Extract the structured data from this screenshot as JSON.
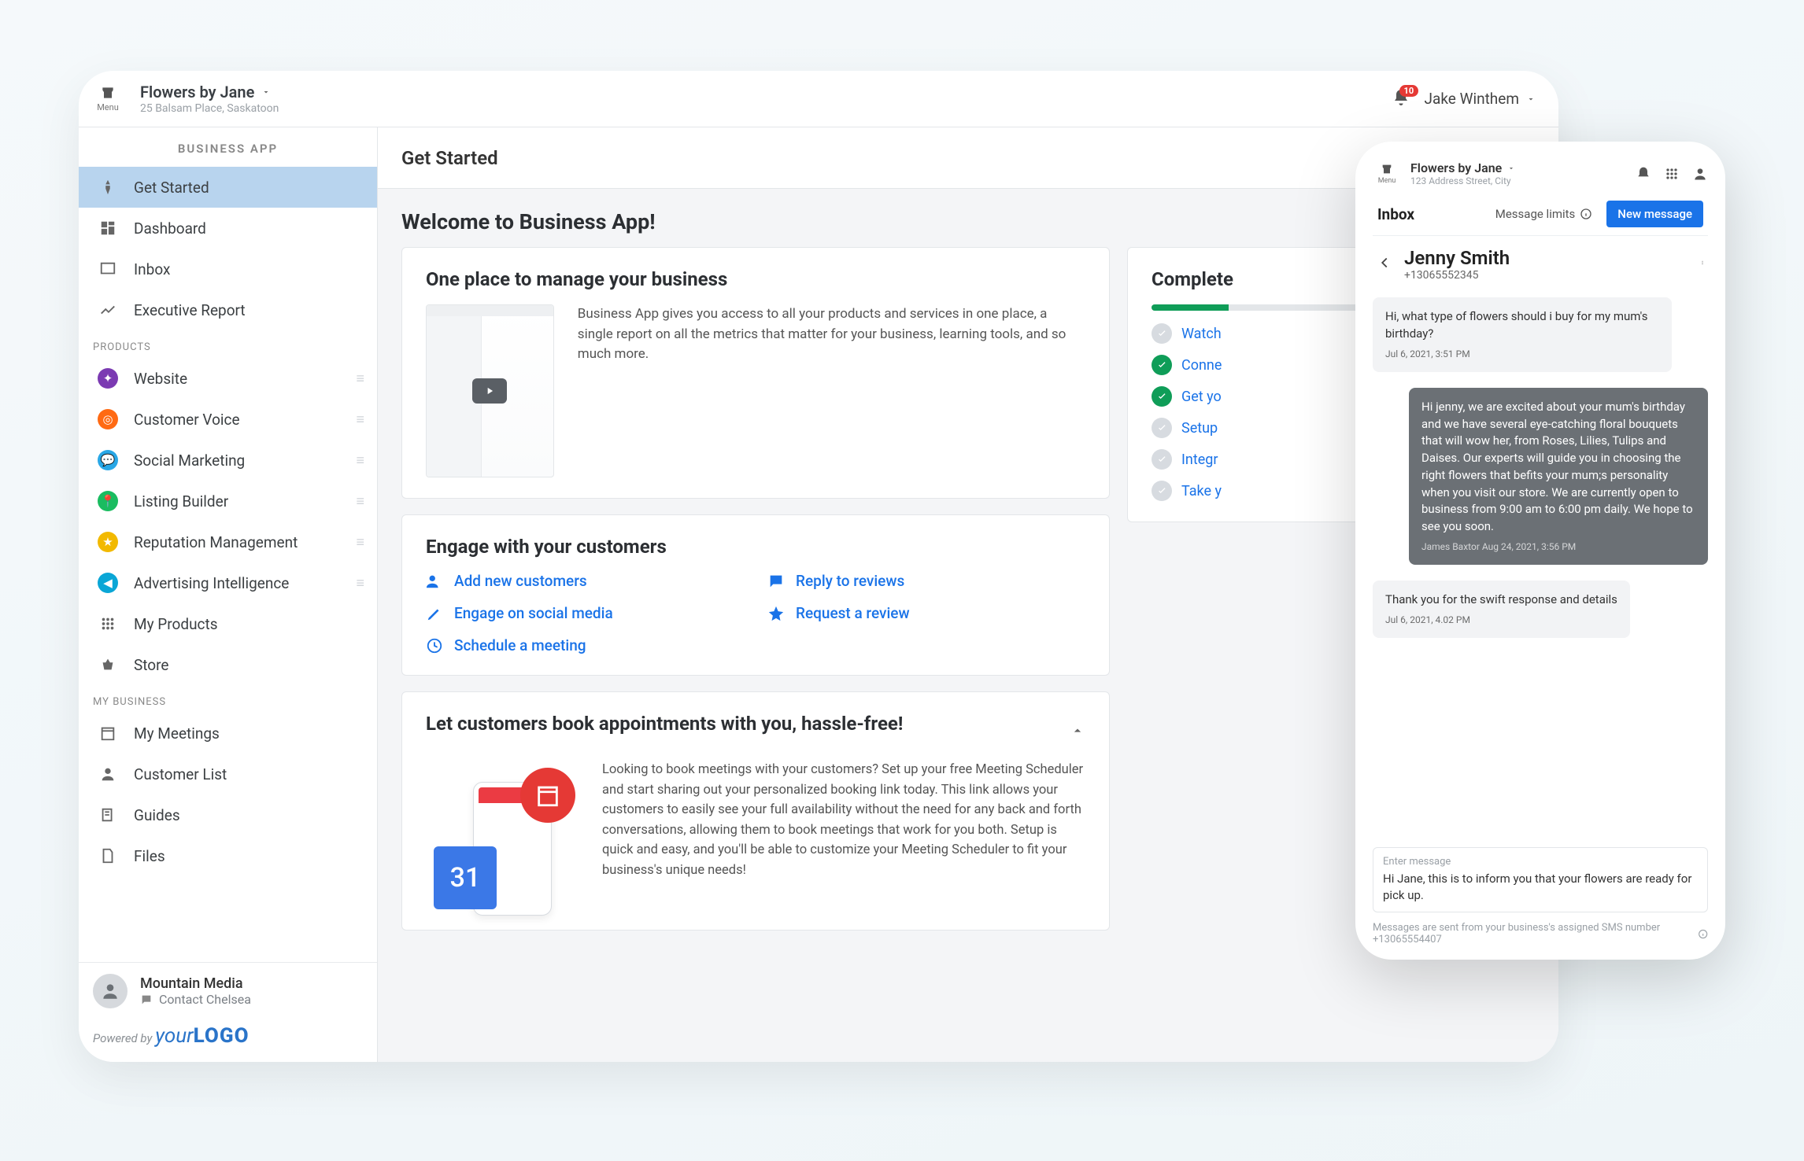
{
  "topbar": {
    "menu_label": "Menu",
    "business_name": "Flowers by Jane",
    "business_address": "25 Balsam Place, Saskatoon",
    "bell_count": "10",
    "user_name": "Jake Winthem"
  },
  "sidebar": {
    "title": "BUSINESS APP",
    "nav": [
      {
        "label": "Get Started"
      },
      {
        "label": "Dashboard"
      },
      {
        "label": "Inbox"
      },
      {
        "label": "Executive Report"
      }
    ],
    "section_products": "PRODUCTS",
    "products": [
      {
        "label": "Website"
      },
      {
        "label": "Customer Voice"
      },
      {
        "label": "Social Marketing"
      },
      {
        "label": "Listing Builder"
      },
      {
        "label": "Reputation Management"
      },
      {
        "label": "Advertising Intelligence"
      },
      {
        "label": "My Products"
      },
      {
        "label": "Store"
      }
    ],
    "section_mybiz": "MY BUSINESS",
    "mybiz": [
      {
        "label": "My Meetings"
      },
      {
        "label": "Customer List"
      },
      {
        "label": "Guides"
      },
      {
        "label": "Files"
      }
    ],
    "footer": {
      "name": "Mountain Media",
      "contact": "Contact Chelsea"
    },
    "powered_label": "Powered by",
    "logo_a": "your",
    "logo_b": "LOGO"
  },
  "main": {
    "header": "Get Started",
    "welcome": "Welcome to Business App!",
    "one_place": {
      "title": "One place to manage your business",
      "body": "Business App gives you access to all your products and services in one place, a single report on all the metrics that matter for your business, learning tools, and so much more."
    },
    "engage": {
      "title": "Engage with your customers",
      "links": [
        "Add new customers",
        "Reply to reviews",
        "Engage on social media",
        "Request a review",
        "Schedule a meeting"
      ]
    },
    "book": {
      "title": "Let customers book appointments with you, hassle-free!",
      "body": "Looking to book meetings with your customers? Set up your free Meeting Scheduler and start sharing out your personalized booking link today. This link allows your customers to easily see your full availability without the need for any back and forth conversations, allowing them to book meetings that work for you both. Setup is quick and easy, and you'll be able to customize your Meeting Scheduler to fit your business's unique needs!",
      "cal_day": "31"
    },
    "setup": {
      "title": "Complete",
      "items": [
        {
          "label": "Watch",
          "done": false
        },
        {
          "label": "Conne",
          "done": true
        },
        {
          "label": "Get yo",
          "done": true
        },
        {
          "label": "Setup",
          "done": false
        },
        {
          "label": "Integr",
          "done": false
        },
        {
          "label": "Take y",
          "done": false
        }
      ]
    }
  },
  "phone": {
    "menu_label": "Menu",
    "business_name": "Flowers by Jane",
    "business_address": "123 Address Street, City",
    "inbox_label": "Inbox",
    "limits_label": "Message limits",
    "new_btn": "New message",
    "contact_name": "Jenny Smith",
    "contact_phone": "+13065552345",
    "msgs": [
      {
        "dir": "in",
        "text": "Hi, what type of flowers should i buy for my mum's birthday?",
        "meta": "Jul 6, 2021, 3:51 PM"
      },
      {
        "dir": "out",
        "text": "Hi jenny, we are excited about your mum's birthday and we have several eye-catching floral bouquets that will wow her, from Roses, Lilies, Tulips and Daises. Our experts will guide you in choosing the right flowers that befits your mum;s personality when you visit our store. We are currently open to business from 9:00 am to 6:00 pm daily. We hope to see you soon.",
        "meta": "James Baxtor Aug 24, 2021, 3:56 PM"
      },
      {
        "dir": "in",
        "text": "Thank you for the swift response and details",
        "meta": "Jul 6, 2021, 4.02 PM"
      }
    ],
    "compose_placeholder": "Enter message",
    "compose_value": "Hi Jane, this is to inform you that your flowers are ready for pick up.",
    "sms_footer": "Messages are sent from your business's assigned SMS number +13065554407"
  }
}
